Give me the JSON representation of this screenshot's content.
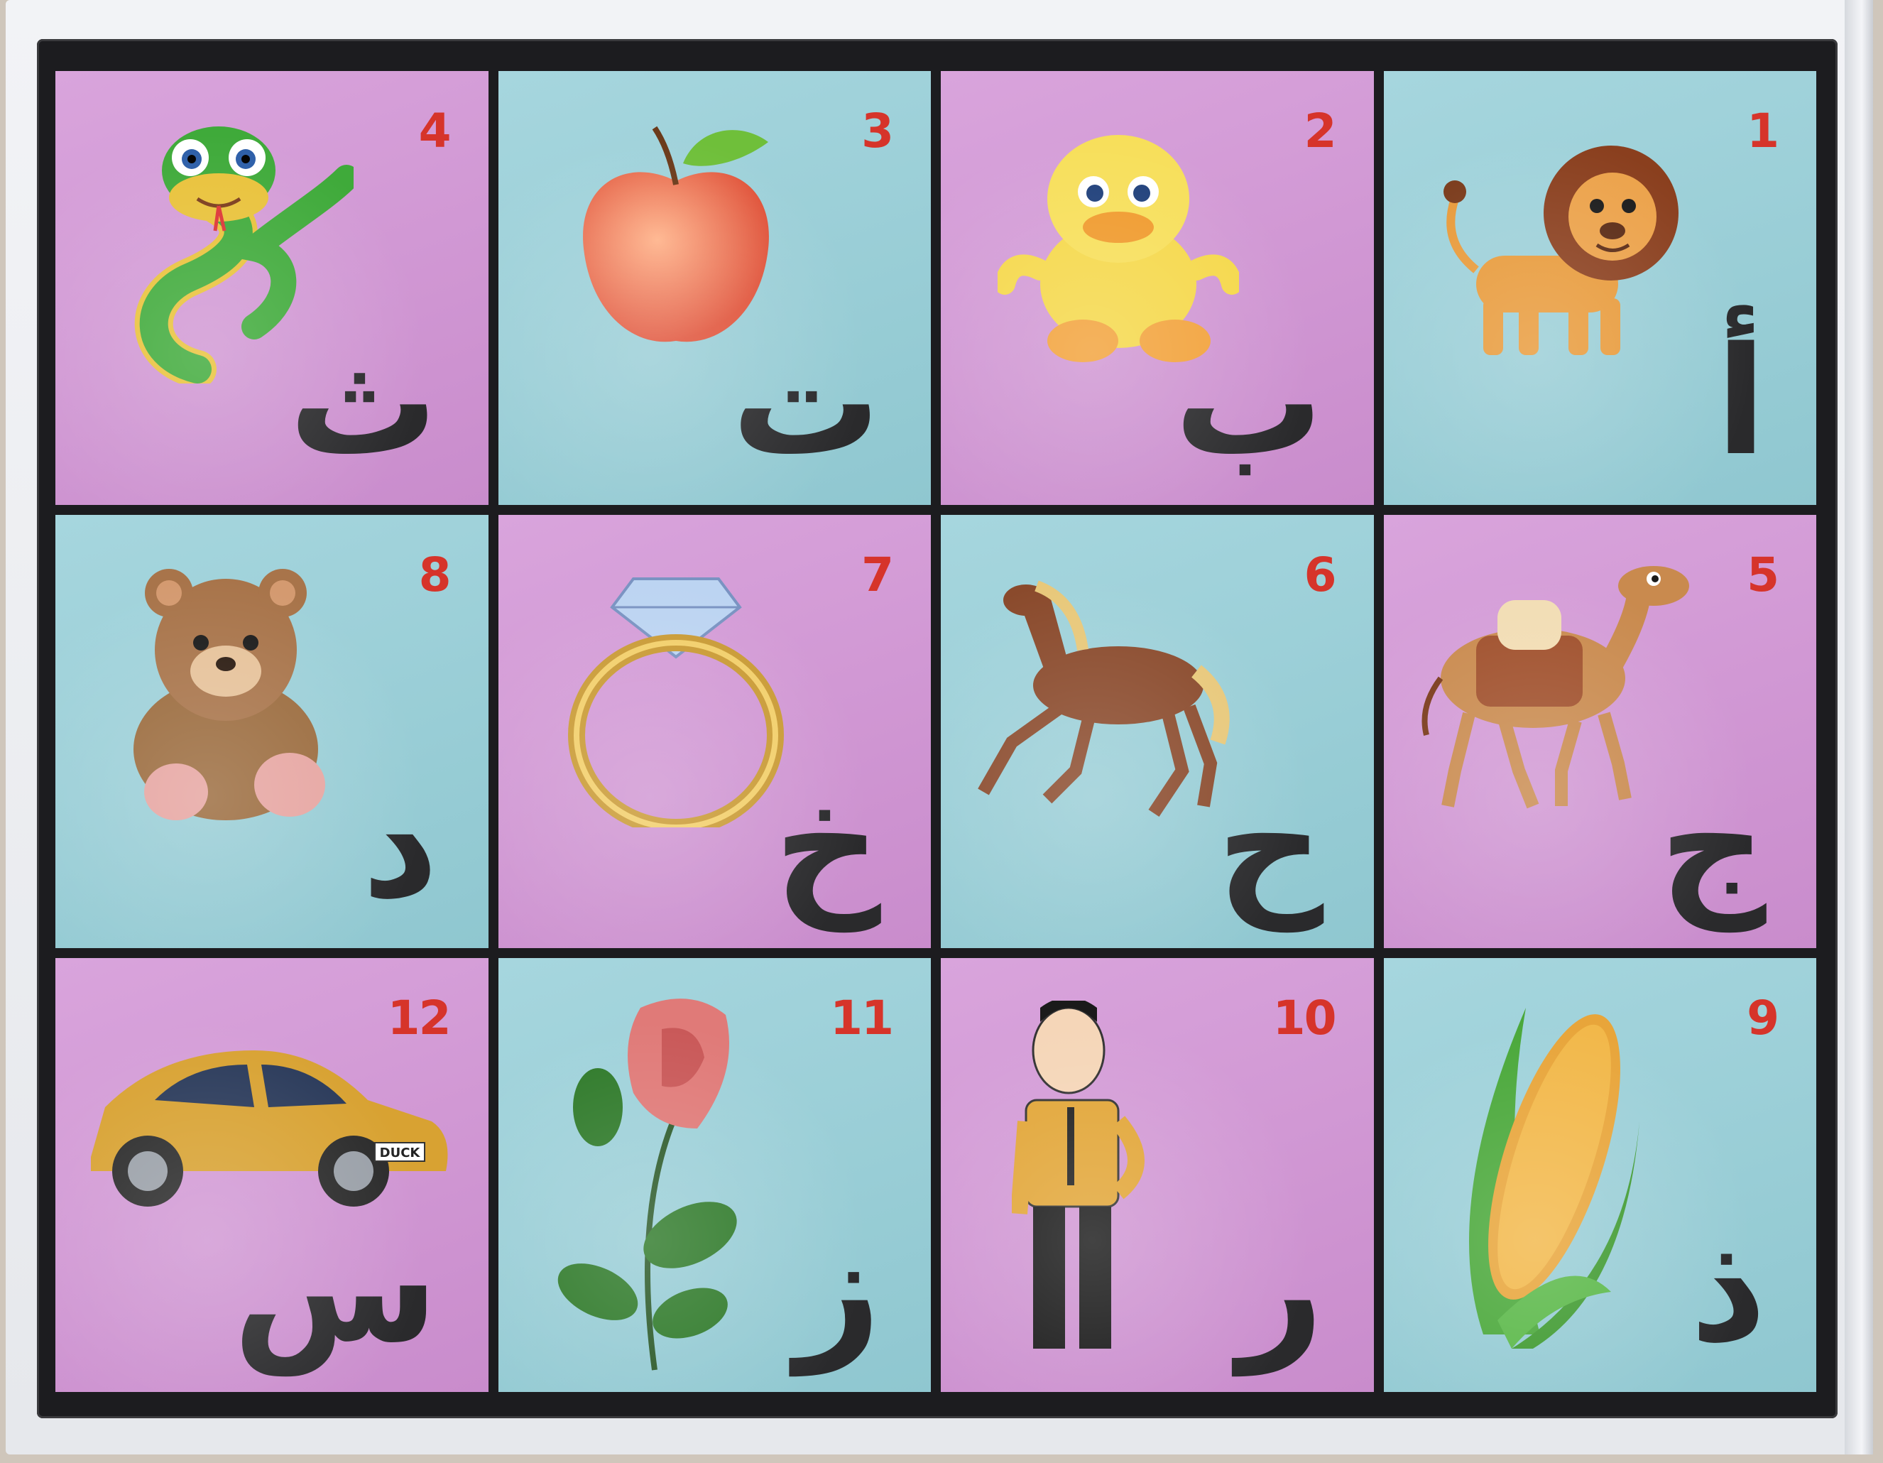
{
  "chart": {
    "rows": [
      [
        {
          "number": "4",
          "letter": "ث",
          "picture": "snake",
          "color": "pink"
        },
        {
          "number": "3",
          "letter": "ت",
          "picture": "apple",
          "color": "blue"
        },
        {
          "number": "2",
          "letter": "ب",
          "picture": "duckling",
          "color": "pink"
        },
        {
          "number": "1",
          "letter": "أ",
          "picture": "lion",
          "color": "blue"
        }
      ],
      [
        {
          "number": "8",
          "letter": "د",
          "picture": "bear",
          "color": "blue"
        },
        {
          "number": "7",
          "letter": "خ",
          "picture": "ring",
          "color": "pink"
        },
        {
          "number": "6",
          "letter": "ح",
          "picture": "horse",
          "color": "blue"
        },
        {
          "number": "5",
          "letter": "ج",
          "picture": "camel",
          "color": "pink"
        }
      ],
      [
        {
          "number": "12",
          "letter": "س",
          "picture": "car",
          "color": "pink",
          "plate": "DUCK"
        },
        {
          "number": "11",
          "letter": "ز",
          "picture": "rose",
          "color": "blue"
        },
        {
          "number": "10",
          "letter": "ر",
          "picture": "man",
          "color": "pink"
        },
        {
          "number": "9",
          "letter": "ذ",
          "picture": "corn",
          "color": "blue"
        }
      ]
    ]
  },
  "colors": {
    "pink": "#d29bd5",
    "blue": "#9dd0d8",
    "number": "#d6342a",
    "letter": "#2a2a2c",
    "frame": "#1c1c1f"
  }
}
